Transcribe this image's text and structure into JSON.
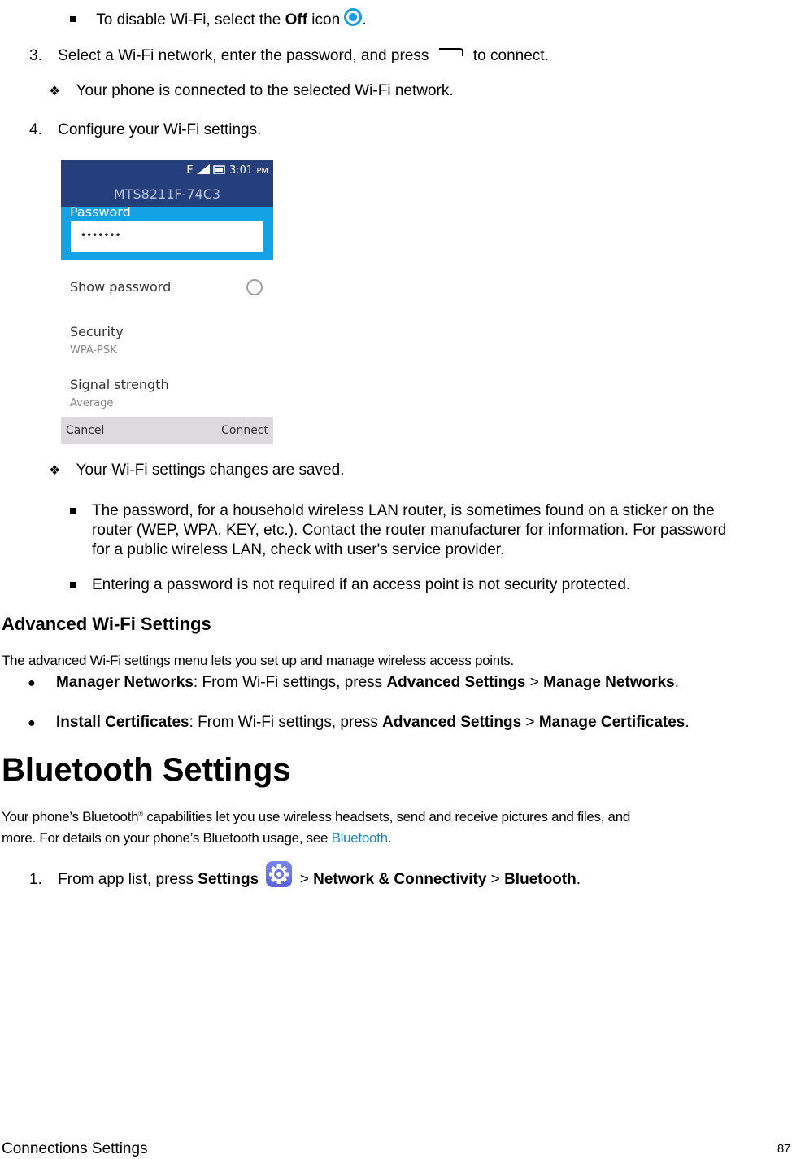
{
  "step_disable": {
    "prefix": "To disable Wi-Fi, select the ",
    "bold": "Off",
    "suffix": " icon",
    "end": ".",
    "icon": "radio-selected-icon"
  },
  "step3": {
    "number": "3.",
    "text_before": "Select a Wi-Fi network, enter the password, and press",
    "text_after": "to connect.",
    "icon": "softkey-right-icon"
  },
  "result1": "Your phone is connected to the selected Wi-Fi network.",
  "step4": {
    "number": "4.",
    "text": "Configure your Wi-Fi settings."
  },
  "phone_screen": {
    "status": {
      "network": "E",
      "time": "3:01",
      "ampm": "PM"
    },
    "title": "MTS8211F-74C3",
    "password_label": "Password",
    "password_value": "•••••••",
    "show_password_label": "Show password",
    "security_label": "Security",
    "security_value": "WPA-PSK",
    "signal_label": "Signal strength",
    "signal_value": "Average",
    "softkey_left": "Cancel",
    "softkey_right": "Connect",
    "colors": {
      "header": "#243f7b",
      "accent": "#13a3e4",
      "softbar": "#dcdadd"
    }
  },
  "result2": "Your Wi-Fi settings changes are saved.",
  "notes": [
    {
      "lines": [
        "The password, for a household wireless LAN router, is sometimes found on a sticker on the",
        "router (WEP, WPA, KEY, etc.). Contact the router manufacturer for information. For password",
        "for a public wireless LAN, check with user's service provider."
      ]
    },
    {
      "lines": [
        "Entering a password is not required if an access point is not security protected."
      ]
    }
  ],
  "advanced": {
    "heading": "Advanced Wi-Fi Settings",
    "intro": "The advanced Wi-Fi settings menu lets you set up and manage wireless access points.",
    "items": [
      {
        "bold": "Manager Networks",
        "text": ": From Wi-Fi settings, press ",
        "b1": "Advanced Settings",
        "sep": " > ",
        "b2": "Manage Networks",
        "end": "."
      },
      {
        "bold": "Install Certificates",
        "text": ": From Wi-Fi settings, press ",
        "b1": "Advanced Settings",
        "sep": " > ",
        "b2": "Manage Certificates",
        "end": "."
      }
    ]
  },
  "bluetooth": {
    "heading": "Bluetooth Settings",
    "para_line1_a": "Your phone’s Bluetooth",
    "para_reg": "®",
    "para_line1_b": " capabilities let you use wireless headsets, send and receive pictures and files, and",
    "para_line2": "more. For details on your phone’s Bluetooth usage, see ",
    "para_link": "Bluetooth",
    "para_end": ".",
    "link_color": "#1a86b8",
    "step1": {
      "number": "1.",
      "text": "From app list, press ",
      "b1": "Settings",
      "sep1": " > ",
      "b2": "Network & Connectivity",
      "sep2": " > ",
      "b3": "Bluetooth",
      "end": ".",
      "icon": "settings-gear-icon"
    }
  },
  "footer": {
    "section": "Connections Settings",
    "page": "87"
  }
}
